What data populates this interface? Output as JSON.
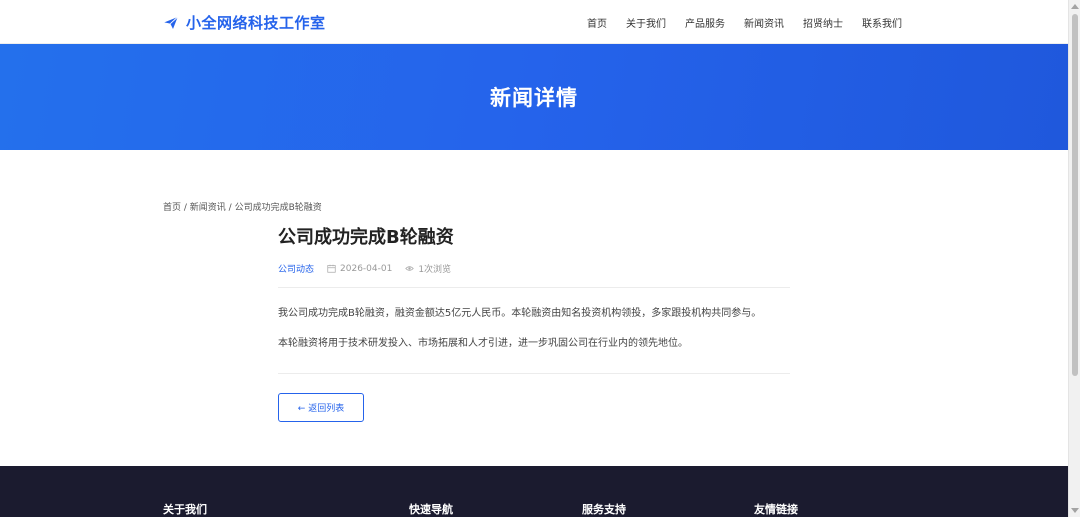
{
  "header": {
    "logo_text": "小全网络科技工作室",
    "nav": [
      "首页",
      "关于我们",
      "产品服务",
      "新闻资讯",
      "招贤纳士",
      "联系我们"
    ]
  },
  "banner": {
    "title": "新闻详情"
  },
  "breadcrumb": {
    "home": "首页",
    "sep": " / ",
    "section": "新闻资讯",
    "current": "公司成功完成B轮融资"
  },
  "article": {
    "title": "公司成功完成B轮融资",
    "category": "公司动态",
    "date": "2026-04-01",
    "views": "1次浏览",
    "paragraphs": [
      "我公司成功完成B轮融资，融资金额达5亿元人民币。本轮融资由知名投资机构领投，多家跟投机构共同参与。",
      "本轮融资将用于技术研发投入、市场拓展和人才引进，进一步巩固公司在行业内的领先地位。"
    ],
    "back_label": "← 返回列表"
  },
  "footer": {
    "columns": [
      "关于我们",
      "快速导航",
      "服务支持",
      "友情链接"
    ]
  },
  "colors": {
    "accent": "#2563eb",
    "footer_bg": "#1b1b2f"
  },
  "icons": [
    "paper-plane-icon",
    "calendar-icon",
    "eye-icon"
  ]
}
